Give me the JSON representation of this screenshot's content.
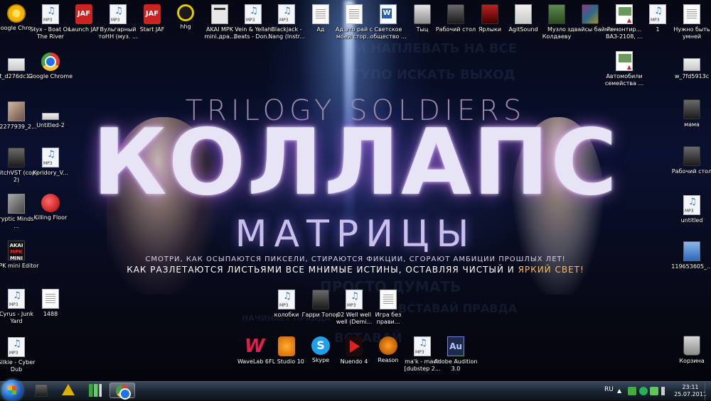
{
  "wallpaper": {
    "subtitle": "TRILOGY SOLDIERS",
    "title": "КОЛЛАПС",
    "title2": "МАТРИЦЫ",
    "line1": "СМОТРИ, КАК ОСЫПАЮТСЯ ПИКСЕЛИ, СТИРАЮТСЯ ФИКЦИИ, СГОРАЮТ АМБИЦИИ ПРОШЛЫХ ЛЕТ!",
    "line2_a": "КАК РАЗЛЕТАЮТСЯ ЛИСТЬЯМИ ВСЕ МНИМЫЕ ИСТИНЫ, ОСТАВЛЯЯ ЧИСТЫЙ И ",
    "line2_b": "ЯРКИЙ СВЕТ!",
    "bg_phrases": [
      "И НАПЛЕВАТЬ НА ВСЕ",
      "ТУПО ИСКАТЬ ВЫХОД",
      "ПРОСТО ДУМАТЬ",
      "ВСТАВАЙ ПРАВДА",
      "НАЧИНАЕТ ПРАВДА",
      "ВСТАВАЙ"
    ]
  },
  "desktop_icons": [
    {
      "label": "Google Chro...",
      "icon": "chrome-yellow-icon"
    },
    {
      "label": "Styx - Boat On The River",
      "icon": "mp3-file-icon"
    },
    {
      "label": "Launch JAF",
      "icon": "jaf-app-icon",
      "glyph": "JAF"
    },
    {
      "label": "Вульгарный тоНН (муз. ...",
      "icon": "mp3-file-icon"
    },
    {
      "label": "Start JAF",
      "icon": "jaf-app-icon",
      "glyph": "JAF"
    },
    {
      "label": "hhg",
      "icon": "program-icon"
    },
    {
      "label": "AKAI MPK mini.дра...",
      "icon": "clip-file-icon"
    },
    {
      "label": "Vein & Yellah Beats - Don...",
      "icon": "mp3-file-icon"
    },
    {
      "label": "Blackjack - Nang (Instr...",
      "icon": "mp3-file-icon"
    },
    {
      "label": "Ад",
      "icon": "text-file-icon"
    },
    {
      "label": "Ад.это рай с моей стор...",
      "icon": "text-file-icon"
    },
    {
      "label": "Светское общество ...",
      "icon": "word-file-icon"
    },
    {
      "label": "Тыц",
      "icon": "folder-icon"
    },
    {
      "label": "Рабочий стол",
      "icon": "folder-icon"
    },
    {
      "label": "Ярлыки",
      "icon": "shortcuts-folder-icon"
    },
    {
      "label": "AgitSound",
      "icon": "image-file-icon"
    },
    {
      "label": "Музло Колдаеву",
      "icon": "music-folder-icon"
    },
    {
      "label": "здвайсы байми",
      "icon": "folder-icon"
    },
    {
      "label": "Ремонтир... ВАЗ-2108, ...",
      "icon": "pdf-file-icon"
    },
    {
      "label": "1",
      "icon": "mp3-file-icon"
    },
    {
      "label": "Нужно быть умней",
      "icon": "text-file-icon"
    },
    {
      "label": "t_d276dc12",
      "icon": "image-file-icon"
    },
    {
      "label": "Google Chrome",
      "icon": "chrome-icon"
    },
    {
      "label": "52277939_2...",
      "icon": "photo-file-icon"
    },
    {
      "label": "Untitled-2",
      "icon": "image-file-icon"
    },
    {
      "label": "GlitchVST (copy 2)",
      "icon": "dark-folder-icon"
    },
    {
      "label": "Koridory_V...",
      "icon": "mp3-file-icon"
    },
    {
      "label": "Kryptic Minds - ...",
      "icon": "photo-file-icon"
    },
    {
      "label": "Killing Floor",
      "icon": "game-icon"
    },
    {
      "label": "MPK mini Editor",
      "icon": "akai-editor-icon"
    },
    {
      "label": "Cyrus - Junk Yard",
      "icon": "mp3-file-icon"
    },
    {
      "label": "1488",
      "icon": "text-file-icon"
    },
    {
      "label": "Silkie - Cyber Dub",
      "icon": "mp3-file-icon"
    },
    {
      "label": "Автомобили семейства ...",
      "icon": "pdf-file-icon"
    },
    {
      "label": "w_7fd5913c",
      "icon": "image-file-icon"
    },
    {
      "label": "мама",
      "icon": "dark-folder-icon"
    },
    {
      "label": "Рабочий стол",
      "icon": "dark-folder-icon"
    },
    {
      "label": "untitled",
      "icon": "mp3-file-icon"
    },
    {
      "label": "119653605_...",
      "icon": "photo-file-icon"
    },
    {
      "label": "Корзина",
      "icon": "recycle-bin-icon"
    },
    {
      "label": "колобки",
      "icon": "mp3-file-icon"
    },
    {
      "label": "Гарри Топор",
      "icon": "dark-folder-icon"
    },
    {
      "label": "02 Well well well (Demi...",
      "icon": "mp3-file-icon"
    },
    {
      "label": "Игра без прави...",
      "icon": "text-file-icon"
    },
    {
      "label": "WaveLab 6",
      "icon": "wavelab-icon",
      "glyph": "W"
    },
    {
      "label": "FL Studio 10",
      "icon": "fl-studio-icon"
    },
    {
      "label": "Skype",
      "icon": "skype-icon",
      "glyph": "S"
    },
    {
      "label": "Nuendo 4",
      "icon": "nuendo-icon"
    },
    {
      "label": "Reason",
      "icon": "reason-icon"
    },
    {
      "label": "ma'k - mach [dubstep 2...",
      "icon": "mp3-file-icon"
    },
    {
      "label": "Adobe Audition 3.0",
      "icon": "adobe-audition-icon",
      "glyph": "Au"
    }
  ],
  "akai_glyph": {
    "top": "AKAI",
    "mid": "MPK",
    "bottom": "MINI"
  },
  "taskbar": {
    "pinned": [
      {
        "name": "explorer",
        "icon": "folder-icon"
      },
      {
        "name": "winamp",
        "icon": "winamp-icon"
      },
      {
        "name": "network",
        "icon": "network-icon"
      },
      {
        "name": "chrome",
        "icon": "chrome-icon",
        "active": true
      }
    ],
    "language": "RU",
    "clock_time": "23:11",
    "clock_date": "25.07.2011"
  },
  "colors": {
    "accent": "#ffbb55",
    "taskbar": "#1a2533",
    "mp3_note": "#2f6fd0"
  }
}
